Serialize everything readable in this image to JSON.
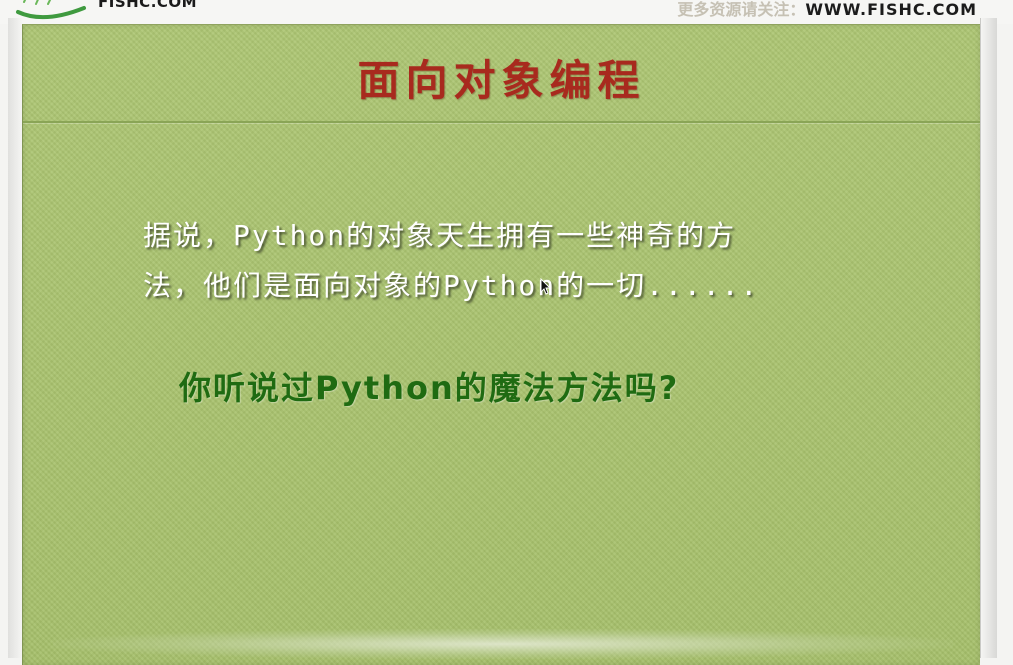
{
  "header": {
    "logo_text": "FISHC.COM",
    "promo_label": "更多资源请关注：",
    "promo_url": "WWW.FISHC.COM"
  },
  "slide": {
    "title": "面向对象编程",
    "paragraph_line1": "据说，Python的对象天生拥有一些神奇的方",
    "paragraph_line2": "法，他们是面向对象的Python的一切......",
    "question": "你听说过Python的魔法方法吗?"
  },
  "colors": {
    "slide_background": "#a8c26c",
    "title": "#a82a1e",
    "question": "#1f6b12",
    "paragraph": "#ffffff"
  },
  "icons": {
    "logo": "fishc-logo-icon",
    "cursor": "mouse-pointer-icon"
  }
}
